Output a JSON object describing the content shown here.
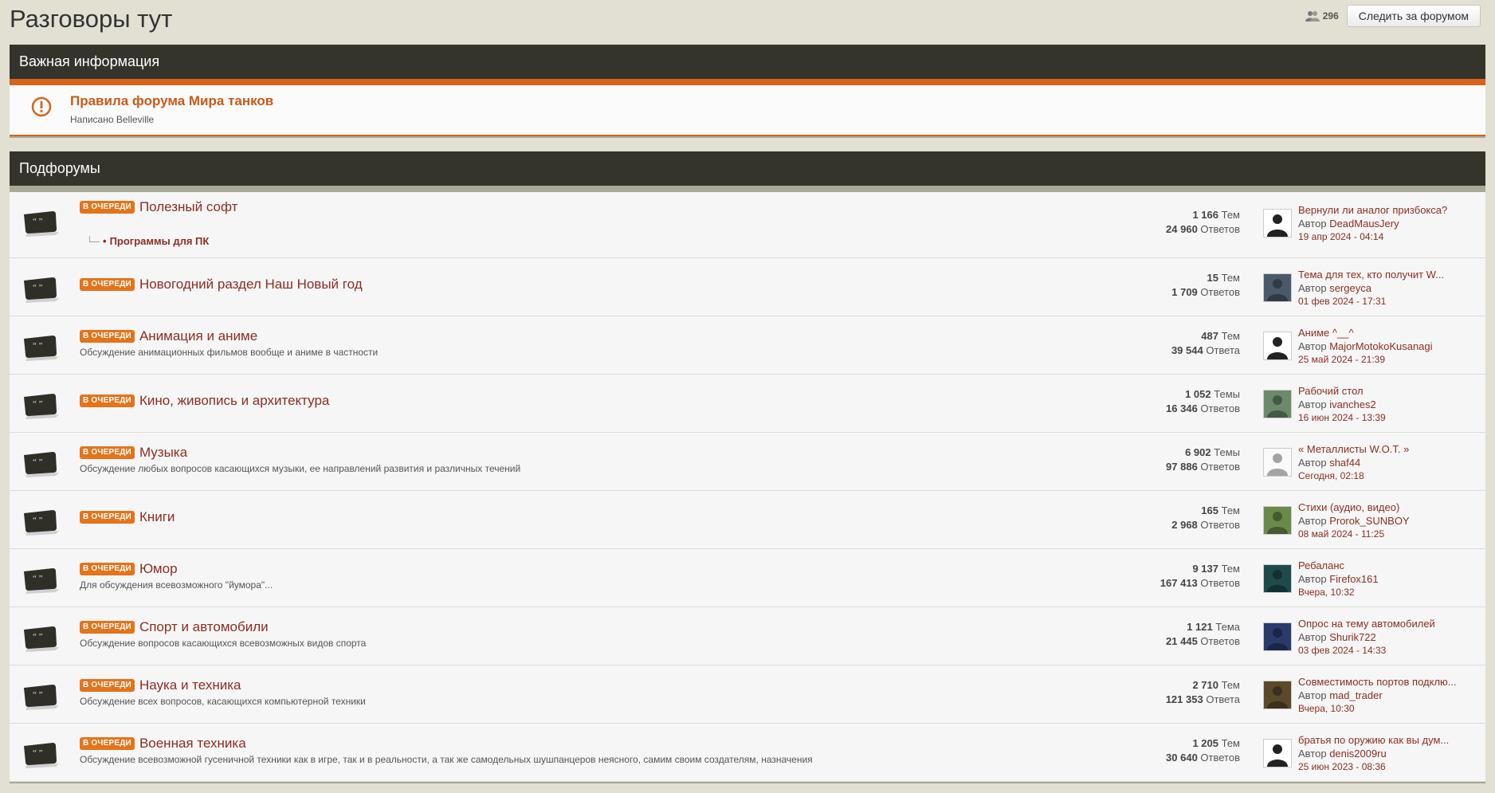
{
  "page": {
    "title": "Разговоры тут",
    "followers_count": "296",
    "follow_label": "Следить за форумом"
  },
  "announcements": {
    "header": "Важная информация",
    "item": {
      "title": "Правила форума Мира танков",
      "by_label": "Написано",
      "author": "Belleville"
    }
  },
  "subforums": {
    "header": "Подфорумы",
    "badge": "В ОЧЕРЕДИ",
    "items": [
      {
        "title": "Полезный софт",
        "description": "",
        "subforum": "Программы для ПК",
        "topics": "1 166",
        "topics_label": "Тем",
        "replies": "24 960",
        "replies_label": "Ответов",
        "last_title": "Вернули ли аналог призбокса?",
        "author_label": "Автор",
        "last_author": "DeadMausJery",
        "last_date": "19 апр 2024 - 04:14"
      },
      {
        "title": "Новогодний раздел Наш Новый год",
        "description": "",
        "topics": "15",
        "topics_label": "Тем",
        "replies": "1 709",
        "replies_label": "Ответов",
        "last_title": "Тема для тех, кто получит W...",
        "author_label": "Автор",
        "last_author": "sergeyca",
        "last_date": "01 фев 2024 - 17:31"
      },
      {
        "title": "Анимация и аниме",
        "description": "Обсуждение анимационных фильмов вообще и аниме в частности",
        "topics": "487",
        "topics_label": "Тем",
        "replies": "39 544",
        "replies_label": "Ответа",
        "last_title": "Аниме ^__^",
        "author_label": "Автор",
        "last_author": "MajorMotokoKusanagi",
        "last_date": "25 май 2024 - 21:39"
      },
      {
        "title": "Кино, живопись и архитектура",
        "description": "",
        "topics": "1 052",
        "topics_label": "Темы",
        "replies": "16 346",
        "replies_label": "Ответов",
        "last_title": "Рабочий стол",
        "author_label": "Автор",
        "last_author": "ivanches2",
        "last_date": "16 июн 2024 - 13:39"
      },
      {
        "title": "Музыка",
        "description": "Обсуждение любых вопросов касающихся музыки, ее направлений развития и различных течений",
        "topics": "6 902",
        "topics_label": "Темы",
        "replies": "97 886",
        "replies_label": "Ответов",
        "last_title": "« Металлисты W.O.T. »",
        "author_label": "Автор",
        "last_author": "shaf44",
        "last_date": "Сегодня, 02:18"
      },
      {
        "title": "Книги",
        "description": "",
        "topics": "165",
        "topics_label": "Тем",
        "replies": "2 968",
        "replies_label": "Ответов",
        "last_title": "Стихи (аудио, видео)",
        "author_label": "Автор",
        "last_author": "Prorok_SUNBOY",
        "last_date": "08 май 2024 - 11:25"
      },
      {
        "title": "Юмор",
        "description": "Для обсуждения всевозможного \"йумора\"...",
        "topics": "9 137",
        "topics_label": "Тем",
        "replies": "167 413",
        "replies_label": "Ответов",
        "last_title": "Ребаланс",
        "author_label": "Автор",
        "last_author": "Firefox161",
        "last_date": "Вчера, 10:32"
      },
      {
        "title": "Спорт и автомобили",
        "description": "Обсуждение вопросов касающихся всевозможных видов спорта",
        "topics": "1 121",
        "topics_label": "Тема",
        "replies": "21 445",
        "replies_label": "Ответов",
        "last_title": "Опрос на тему автомобилей",
        "author_label": "Автор",
        "last_author": "Shurik722",
        "last_date": "03 фев 2024 - 14:33"
      },
      {
        "title": "Наука и техника",
        "description": "Обсуждение всех вопросов, касающихся компьютерной техники",
        "topics": "2 710",
        "topics_label": "Тем",
        "replies": "121 353",
        "replies_label": "Ответа",
        "last_title": "Совместимость портов подклю...",
        "author_label": "Автор",
        "last_author": "mad_trader",
        "last_date": "Вчера, 10:30"
      },
      {
        "title": "Военная техника",
        "description": "Обсуждение всевозможной гусеничной техники как в игре, так и в реальности, а так же самодельных шушпанцеров неясного, самим своим создателям, назначения",
        "topics": "1 205",
        "topics_label": "Тем",
        "replies": "30 640",
        "replies_label": "Ответов",
        "last_title": "братья по оружию как вы дум...",
        "author_label": "Автор",
        "last_author": "denis2009ru",
        "last_date": "25 июн 2023 - 08:36"
      }
    ]
  },
  "colors": {
    "header_bg": "#35342c",
    "accent_orange": "#d8631b",
    "link": "#8c2d23"
  },
  "icons": {
    "forum": "speech-bubble-icon",
    "announce": "exclamation-circle-icon",
    "followers": "people-icon"
  }
}
